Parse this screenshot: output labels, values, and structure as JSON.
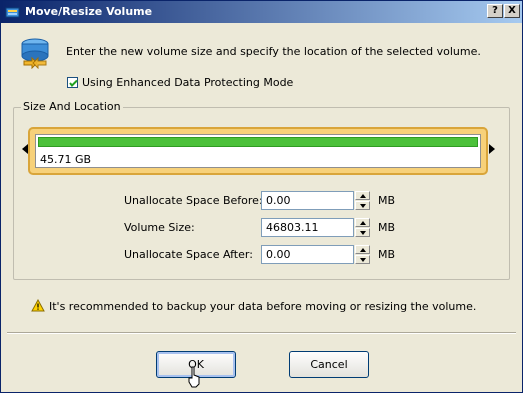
{
  "window": {
    "title": "Move/Resize Volume",
    "help_button": "?",
    "close_button": "X"
  },
  "header": {
    "instruction": "Enter the new volume size and specify the location of the selected volume."
  },
  "options": {
    "enhanced_protect_label": "Using Enhanced Data Protecting Mode",
    "enhanced_protect_checked": true
  },
  "size_location": {
    "group_label": "Size And Location",
    "partition_size_label": "45.71 GB",
    "fields": [
      {
        "label": "Unallocate Space Before:",
        "value": "0.00",
        "unit": "MB"
      },
      {
        "label": "Volume Size:",
        "value": "46803.11",
        "unit": "MB"
      },
      {
        "label": "Unallocate Space After:",
        "value": "0.00",
        "unit": "MB"
      }
    ]
  },
  "warning": {
    "text": "It's recommended to backup your data before moving or resizing the volume."
  },
  "buttons": {
    "ok_label": "OK",
    "cancel_label": "Cancel"
  },
  "colors": {
    "titlebar": "#0a246a",
    "partition_used": "#4cc13a",
    "partition_frame": "#f7d17a"
  }
}
